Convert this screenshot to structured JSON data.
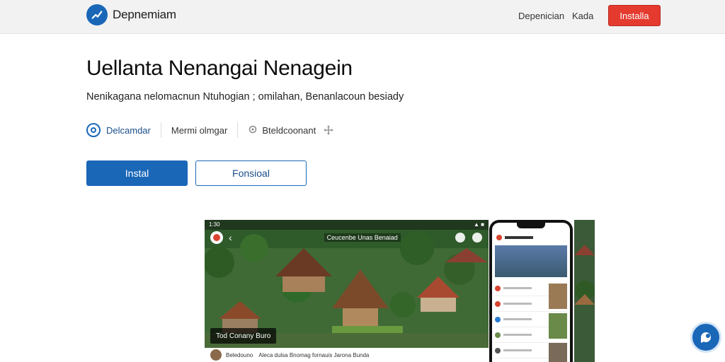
{
  "header": {
    "brand": "Depnemiam",
    "nav": [
      "Depenician",
      "Kada"
    ],
    "install_label": "Installa"
  },
  "hero": {
    "title": "Uellanta Nenangai Nenagein",
    "subtitle": "Nenikagana nelomacnun Ntuhogian ; omilahan, Benanlacoun besiady",
    "meta": {
      "developer": "Delcamdar",
      "category": "Mermi olmgar",
      "location": "Bteldcoonant"
    },
    "primary_button": "Instal",
    "secondary_button": "Fonsioal"
  },
  "showcase": {
    "status_time": "1:30",
    "desktop_title": "Ceucenbe Unas Benaiad",
    "caption": "Tod Conany Buro",
    "strip_name": "Beledouno",
    "strip_text": "Aleca dulsa Bnomag fornauis Jarona Bunda"
  },
  "icons": {
    "logo": "pencil-check-icon",
    "developer": "circle-logo-icon",
    "location": "pin-icon",
    "move": "move-icon",
    "fab": "chat-bubble-icon"
  },
  "colors": {
    "brand_blue": "#1a67b8",
    "install_red": "#e53b2f"
  }
}
